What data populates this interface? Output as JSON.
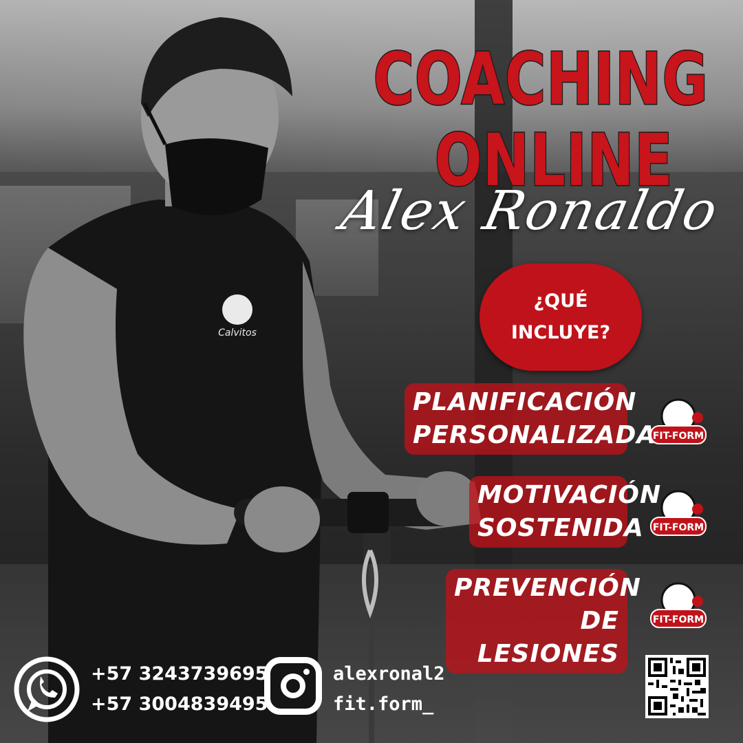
{
  "title": {
    "line1": "COACHING",
    "line2": "ONLINE",
    "script": "Alex Ronaldo"
  },
  "question": {
    "line1": "¿QUÉ",
    "line2": "INCLUYE?"
  },
  "features": [
    {
      "line1": "PLANIFICACIÓN",
      "line2": "PERSONALIZADA",
      "logo": "FIT-FORM"
    },
    {
      "line1": "MOTIVACIÓN",
      "line2": "SOSTENIDA",
      "logo": "FIT-FORM"
    },
    {
      "line1": "PREVENCIÓN",
      "line2": "DE LESIONES",
      "logo": "FIT-FORM"
    }
  ],
  "shirt_logo": "Calvitos",
  "contact": {
    "phones": [
      "+57 3243739695",
      "+57 3004839495"
    ],
    "handles": [
      "alexronal2",
      "fit.form_"
    ],
    "whatsapp_icon": "whatsapp-icon",
    "instagram_icon": "instagram-icon",
    "qr_icon": "qr-code"
  },
  "colors": {
    "accent": "#c0121a",
    "text": "#ffffff"
  }
}
